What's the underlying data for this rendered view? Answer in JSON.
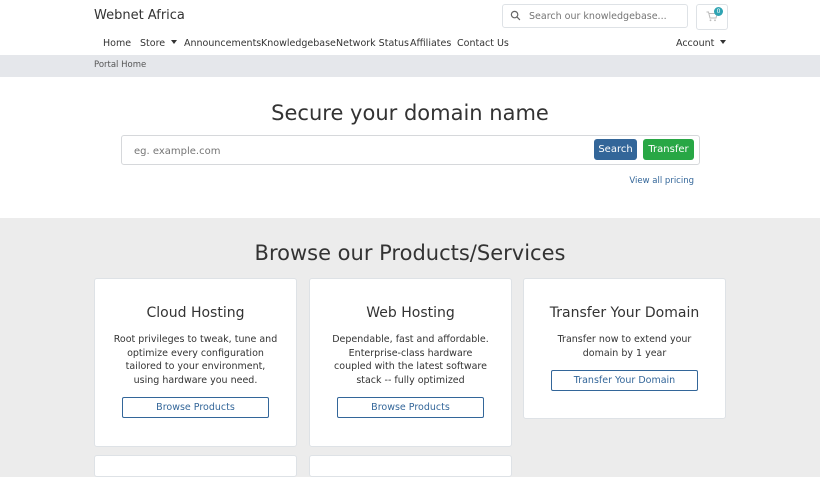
{
  "header": {
    "brand": "Webnet Africa",
    "search_placeholder": "Search our knowledgebase...",
    "cart_count": "0"
  },
  "nav": {
    "items": [
      "Home",
      "Store",
      "Announcements",
      "Knowledgebase",
      "Network Status",
      "Affiliates",
      "Contact Us"
    ],
    "account": "Account"
  },
  "breadcrumb": "Portal Home",
  "domain_search": {
    "title": "Secure your domain name",
    "placeholder": "eg. example.com",
    "search_label": "Search",
    "transfer_label": "Transfer",
    "pricing_link": "View all pricing"
  },
  "products": {
    "title": "Browse our Products/Services",
    "cards": [
      {
        "title": "Cloud Hosting",
        "lines": [
          "Root privileges to tweak, tune and",
          "optimize every configuration",
          "tailored to your environment,",
          "using hardware you need."
        ],
        "button": "Browse Products"
      },
      {
        "title": "Web Hosting",
        "lines": [
          "Dependable, fast and affordable.",
          "Enterprise-class hardware",
          "coupled with the latest software",
          "stack -- fully optimized"
        ],
        "button": "Browse Products"
      },
      {
        "title": "Transfer Your Domain",
        "lines": [
          "Transfer now to extend your",
          "domain by 1 year"
        ],
        "button": "Transfer Your Domain"
      }
    ]
  },
  "colors": {
    "primary": "#336699",
    "success": "#28a745",
    "badge": "#2fa4b3",
    "page_bg": "#ececec"
  }
}
